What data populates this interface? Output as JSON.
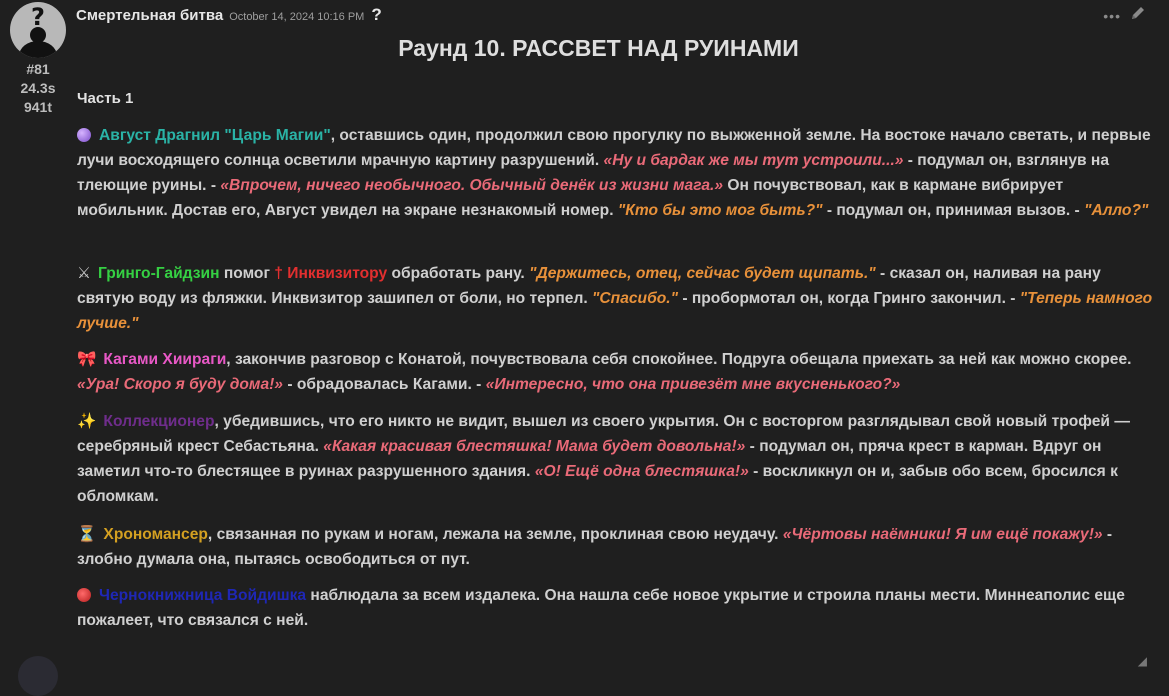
{
  "post": {
    "author": "Смертельная битва",
    "date": "October 14, 2024 10:16 PM",
    "help_mark": "?",
    "post_number": "#81",
    "time_stat": "24.3s",
    "token_stat": "941t",
    "avatar_glyph": "?",
    "more_icon": "•••"
  },
  "content": {
    "title": "Раунд 10. РАССВЕТ НАД РУИНАМИ",
    "part": "Часть 1",
    "paragraphs": [
      {
        "icon": "crystal-ball-icon",
        "name": "Август Драгнил \"Царь Магии\"",
        "name_color": "#2ab3a6",
        "t1": ", оставшись один, продолжил свою прогулку по выжженной земле. На востоке начало светать, и первые лучи восходящего солнца осветили мрачную картину разрушений. ",
        "q1": "«Ну и бардак же мы тут устроили...»",
        "t2": " - подумал он, взглянув на тлеющие руины. - ",
        "q2": "«Впрочем, ничего необычного. Обычный денёк из жизни мага.»",
        "t3": " Он почувствовал, как в кармане вибрирует мобильник. Достав его, Август увидел на экране незнакомый номер. ",
        "q3": "\"Кто бы это мог быть?\"",
        "t4": " - подумал он, принимая вызов. - ",
        "q4": "\"Алло?\""
      },
      {
        "icon": "crossed-swords-icon",
        "name": "Гринго-Гайдзин",
        "name_color": "#35d043",
        "t1": " помог ",
        "name2": "† Инквизитору",
        "name2_color": "#e22f2f",
        "t2": " обработать рану. ",
        "q1": "\"Держитесь, отец, сейчас будет щипать.\"",
        "t3": " - сказал он, наливая на рану святую воду из фляжки. Инквизитор зашипел от боли, но терпел. ",
        "q2": "\"Спасибо.\"",
        "t4": " - пробормотал он, когда Гринго закончил. - ",
        "q3": "\"Теперь намного лучше.\""
      },
      {
        "icon": "ribbon-bow-icon",
        "name": "Кагами Хиираги",
        "name_color": "#e858c6",
        "t1": ", закончив разговор с Конатой, почувствовала себя спокойнее. Подруга обещала приехать за ней как можно скорее. ",
        "q1": "«Ура! Скоро я буду дома!»",
        "t2": " - обрадовалась Кагами. - ",
        "q2": "«Интересно, что она привезёт мне вкусненького?»"
      },
      {
        "icon": "sparkles-icon",
        "name": "Коллекционер",
        "name_color": "#6f2d8c",
        "t1": ", убедившись, что его никто не видит, вышел из своего укрытия. Он с восторгом разглядывал свой новый трофей — серебряный крест Себастьяна. ",
        "q1": "«Какая красивая блестяшка! Мама будет довольна!»",
        "t2": " - подумал он, пряча крест в карман. Вдруг он заметил что-то блестящее в руинах разрушенного здания. ",
        "q2": "«О! Ещё одна блестяшка!»",
        "t3": " - воскликнул он и, забыв обо всем, бросился к обломкам."
      },
      {
        "icon": "hourglass-icon",
        "name": "Хрономансер",
        "name_color": "#d4a021",
        "t1": ", связанная по рукам и ногам, лежала на земле, проклиная свою неудачу. ",
        "q1": "«Чёртовы наёмники! Я им ещё покажу!»",
        "t2": " - злобно думала она, пытаясь освободиться от пут."
      },
      {
        "icon": "devil-face-icon",
        "name": "Чернокнижница Войдишка",
        "name_color": "#1f27b5",
        "t1": " наблюдала за всем издалека. Она нашла себе новое укрытие и строила планы мести. Миннеаполис еще пожалеет, что связался с ней."
      }
    ]
  }
}
